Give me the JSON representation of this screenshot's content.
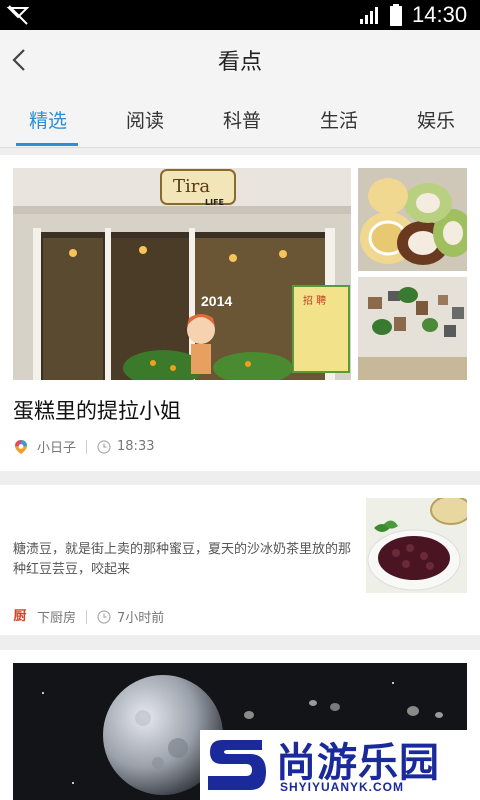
{
  "status_bar": {
    "time": "14:30"
  },
  "header": {
    "title": "看点"
  },
  "tabs": [
    {
      "label": "精选",
      "active": true
    },
    {
      "label": "阅读",
      "active": false
    },
    {
      "label": "科普",
      "active": false
    },
    {
      "label": "生活",
      "active": false
    },
    {
      "label": "娱乐",
      "active": false
    }
  ],
  "articles": [
    {
      "title": "蛋糕里的提拉小姐",
      "source": "小日子",
      "time": "18:33",
      "image_texts": {
        "shop_sign": "Tira",
        "shop_sign_sub": "LIFE",
        "year": "2014",
        "poster": "招 聘"
      }
    },
    {
      "summary": "糖渍豆，就是街上卖的那种蜜豆，夏天的沙冰奶茶里放的那种红豆芸豆，咬起来",
      "source": "下厨房",
      "source_icon_text": "厨",
      "time": "7小时前"
    }
  ],
  "watermark": {
    "cn": "尚游乐园",
    "en": "SHYIYUANYK.COM"
  },
  "colors": {
    "accent": "#2b8fd7",
    "watermark": "#1a2a9a"
  }
}
